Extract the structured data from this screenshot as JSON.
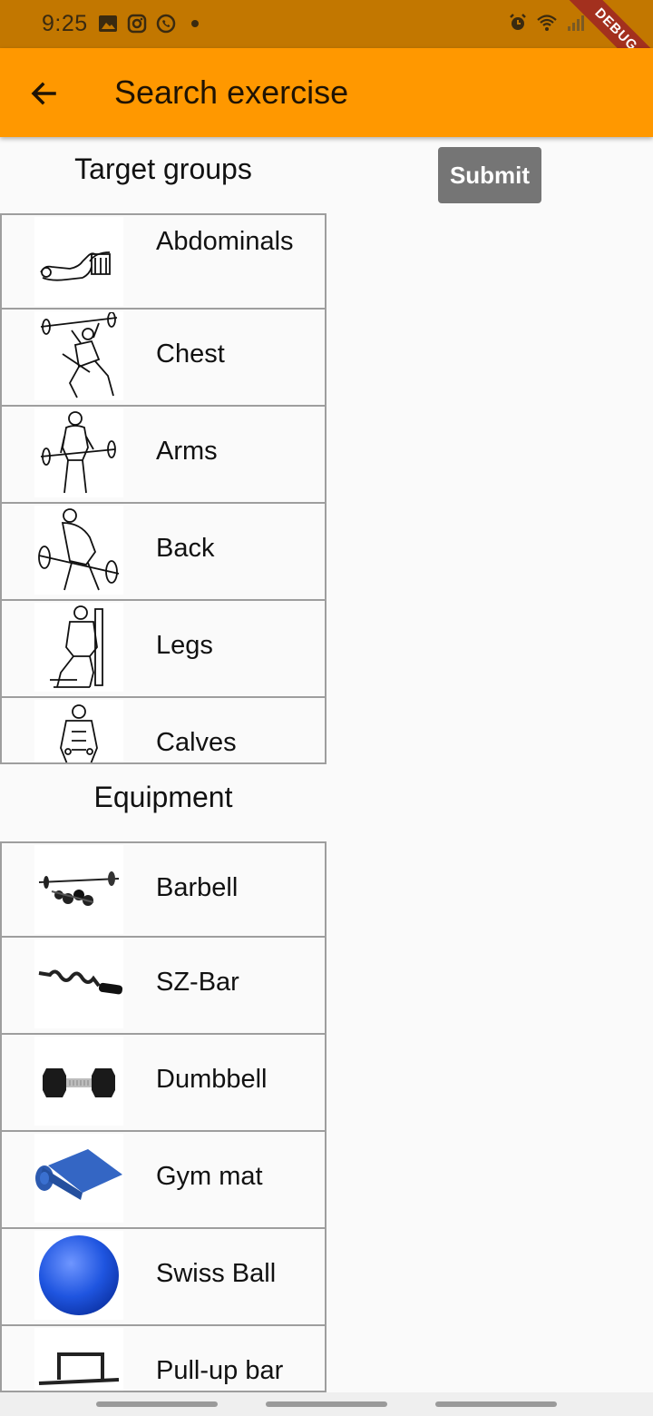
{
  "status_bar": {
    "time": "9:25",
    "left_icons": [
      "image-icon",
      "instagram-icon",
      "whatsapp-icon",
      "dot-icon"
    ],
    "right_icons": [
      "alarm-icon",
      "wifi-icon",
      "signal-icon"
    ]
  },
  "debug_banner": "DEBUG",
  "app_bar": {
    "back_icon": "arrow-back-icon",
    "title": "Search exercise"
  },
  "submit_label": "Submit",
  "target_groups": {
    "title": "Target groups",
    "items": [
      {
        "label": "Abdominals",
        "icon": "abdominals-figure-icon"
      },
      {
        "label": "Chest",
        "icon": "chest-figure-icon"
      },
      {
        "label": "Arms",
        "icon": "arms-figure-icon"
      },
      {
        "label": "Back",
        "icon": "back-figure-icon"
      },
      {
        "label": "Legs",
        "icon": "legs-figure-icon"
      },
      {
        "label": "Calves",
        "icon": "calves-figure-icon"
      }
    ]
  },
  "equipment": {
    "title": "Equipment",
    "items": [
      {
        "label": "Barbell",
        "icon": "barbell-icon"
      },
      {
        "label": "SZ-Bar",
        "icon": "sz-bar-icon"
      },
      {
        "label": "Dumbbell",
        "icon": "dumbbell-icon"
      },
      {
        "label": "Gym mat",
        "icon": "gym-mat-icon"
      },
      {
        "label": "Swiss Ball",
        "icon": "swiss-ball-icon"
      },
      {
        "label": "Pull-up bar",
        "icon": "pull-up-bar-icon"
      }
    ]
  },
  "colors": {
    "status_bar": "#c27700",
    "app_bar": "#ff9800",
    "submit_button": "#757575",
    "debug_banner": "#a3301e",
    "swiss_ball": "#1f55e0",
    "gym_mat": "#3466c4"
  }
}
